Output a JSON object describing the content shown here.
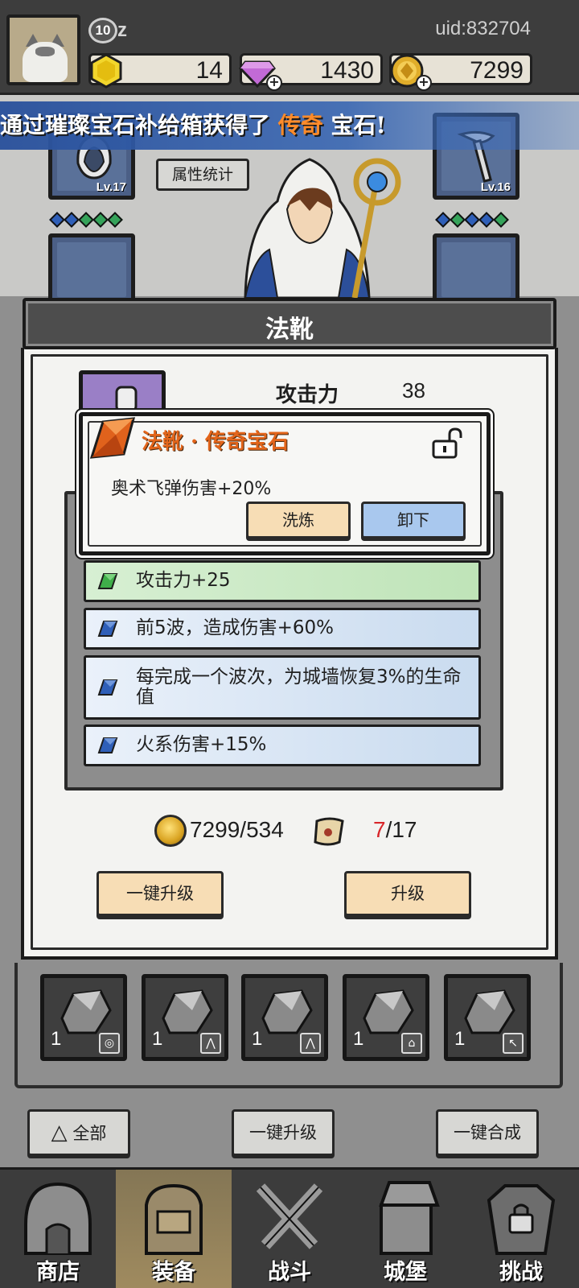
{
  "player": {
    "level": "10",
    "name": "z",
    "uid": "uid:832704"
  },
  "resources": {
    "gold_hex": "14",
    "diamonds": "1430",
    "coins": "7299"
  },
  "banner": {
    "prefix": "通过璀璨宝石补给箱获得了",
    "highlight": "传奇",
    "suffix": "宝石!"
  },
  "equipment": {
    "left_top_level": "Lv.17",
    "right_top_level": "Lv.16",
    "stats_button": "属性统计",
    "left_gems": [
      "#2f5fb8",
      "#2f5fb8",
      "#35a35a",
      "#35a35a",
      "#35a35a"
    ],
    "right_gems": [
      "#2f5fb8",
      "#35a35a",
      "#2f5fb8",
      "#2f5fb8",
      "#35a35a"
    ]
  },
  "modal": {
    "title": "法靴",
    "attack_label": "攻击力",
    "attack_value": "38",
    "popup": {
      "title": "法靴 · 传奇宝石",
      "description": "奥术飞弹伤害+20%",
      "refine_button": "洗炼",
      "unequip_button": "卸下"
    },
    "gem_effects": [
      {
        "text": "攻击力+25",
        "color": "green"
      },
      {
        "text": "前5波，造成伤害+60%",
        "color": "blue"
      },
      {
        "text": "每完成一个波次，为城墙恢复3%的生命值",
        "color": "blue"
      },
      {
        "text": "火系伤害+15%",
        "color": "blue"
      }
    ],
    "cost": {
      "coins": "7299/534",
      "scroll_have": "7",
      "scroll_need": "/17"
    },
    "upgrade_all_button": "一键升级",
    "upgrade_button": "升级"
  },
  "inventory": {
    "items": [
      {
        "count": "1",
        "type": "◎"
      },
      {
        "count": "1",
        "type": "⋀"
      },
      {
        "count": "1",
        "type": "⋀"
      },
      {
        "count": "1",
        "type": "⌂"
      },
      {
        "count": "1",
        "type": "↖"
      }
    ]
  },
  "bottom_buttons": {
    "filter": "全部",
    "upgrade_all": "一键升级",
    "merge_all": "一键合成"
  },
  "nav": {
    "shop": "商店",
    "equip": "装备",
    "battle": "战斗",
    "castle": "城堡",
    "challenge": "挑战"
  }
}
